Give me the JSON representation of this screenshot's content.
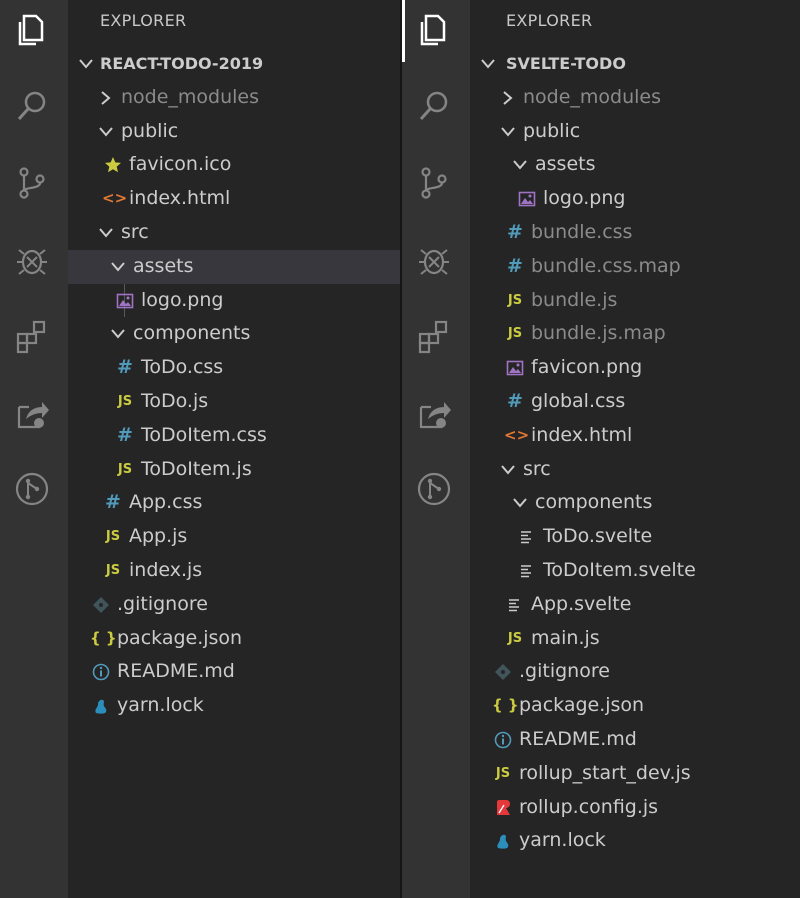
{
  "left": {
    "header": "EXPLORER",
    "root_label": "REACT-TODO-2019",
    "tree": [
      {
        "label": "node_modules",
        "kind": "folder-collapsed",
        "depth": 1,
        "dim": true
      },
      {
        "label": "public",
        "kind": "folder-open",
        "depth": 1
      },
      {
        "label": "favicon.ico",
        "kind": "star",
        "depth": 2
      },
      {
        "label": "index.html",
        "kind": "html",
        "depth": 2
      },
      {
        "label": "src",
        "kind": "folder-open",
        "depth": 1
      },
      {
        "label": "assets",
        "kind": "folder-open",
        "depth": 2,
        "selected": true
      },
      {
        "label": "logo.png",
        "kind": "image",
        "depth": 3
      },
      {
        "label": "components",
        "kind": "folder-open",
        "depth": 2
      },
      {
        "label": "ToDo.css",
        "kind": "css",
        "depth": 3
      },
      {
        "label": "ToDo.js",
        "kind": "js",
        "depth": 3
      },
      {
        "label": "ToDoItem.css",
        "kind": "css",
        "depth": 3
      },
      {
        "label": "ToDoItem.js",
        "kind": "js",
        "depth": 3
      },
      {
        "label": "App.css",
        "kind": "css",
        "depth": 2
      },
      {
        "label": "App.js",
        "kind": "js",
        "depth": 2
      },
      {
        "label": "index.js",
        "kind": "js",
        "depth": 2
      },
      {
        "label": ".gitignore",
        "kind": "git",
        "depth": 1
      },
      {
        "label": "package.json",
        "kind": "json",
        "depth": 1
      },
      {
        "label": "README.md",
        "kind": "info",
        "depth": 1
      },
      {
        "label": "yarn.lock",
        "kind": "yarn",
        "depth": 1
      }
    ]
  },
  "right": {
    "header": "EXPLORER",
    "root_label": "SVELTE-TODO",
    "tree": [
      {
        "label": "node_modules",
        "kind": "folder-collapsed",
        "depth": 1,
        "dim": true
      },
      {
        "label": "public",
        "kind": "folder-open",
        "depth": 1
      },
      {
        "label": "assets",
        "kind": "folder-open",
        "depth": 2
      },
      {
        "label": "logo.png",
        "kind": "image",
        "depth": 3
      },
      {
        "label": "bundle.css",
        "kind": "css",
        "depth": 2,
        "dim": true
      },
      {
        "label": "bundle.css.map",
        "kind": "css",
        "depth": 2,
        "dim": true
      },
      {
        "label": "bundle.js",
        "kind": "js",
        "depth": 2,
        "dim": true
      },
      {
        "label": "bundle.js.map",
        "kind": "js",
        "depth": 2,
        "dim": true
      },
      {
        "label": "favicon.png",
        "kind": "image",
        "depth": 2
      },
      {
        "label": "global.css",
        "kind": "css",
        "depth": 2
      },
      {
        "label": "index.html",
        "kind": "html",
        "depth": 2
      },
      {
        "label": "src",
        "kind": "folder-open",
        "depth": 1
      },
      {
        "label": "components",
        "kind": "folder-open",
        "depth": 2
      },
      {
        "label": "ToDo.svelte",
        "kind": "lines",
        "depth": 3
      },
      {
        "label": "ToDoItem.svelte",
        "kind": "lines",
        "depth": 3
      },
      {
        "label": "App.svelte",
        "kind": "lines",
        "depth": 2
      },
      {
        "label": "main.js",
        "kind": "js",
        "depth": 2
      },
      {
        "label": ".gitignore",
        "kind": "git",
        "depth": 1
      },
      {
        "label": "package.json",
        "kind": "json",
        "depth": 1
      },
      {
        "label": "README.md",
        "kind": "info",
        "depth": 1
      },
      {
        "label": "rollup_start_dev.js",
        "kind": "js",
        "depth": 1
      },
      {
        "label": "rollup.config.js",
        "kind": "rollup",
        "depth": 1
      },
      {
        "label": "yarn.lock",
        "kind": "yarn",
        "depth": 1
      }
    ]
  },
  "activity_bar": [
    "files-icon",
    "search-icon",
    "source-control-icon",
    "debug-icon",
    "extensions-icon",
    "live-share-icon",
    "git-graph-icon"
  ],
  "colors": {
    "css": "#519aba",
    "js": "#cbcb41",
    "html": "#e37933",
    "image": "#a074c4",
    "git": "#41535b",
    "rollup": "#e5383b",
    "yarn": "#2c8ebb"
  }
}
